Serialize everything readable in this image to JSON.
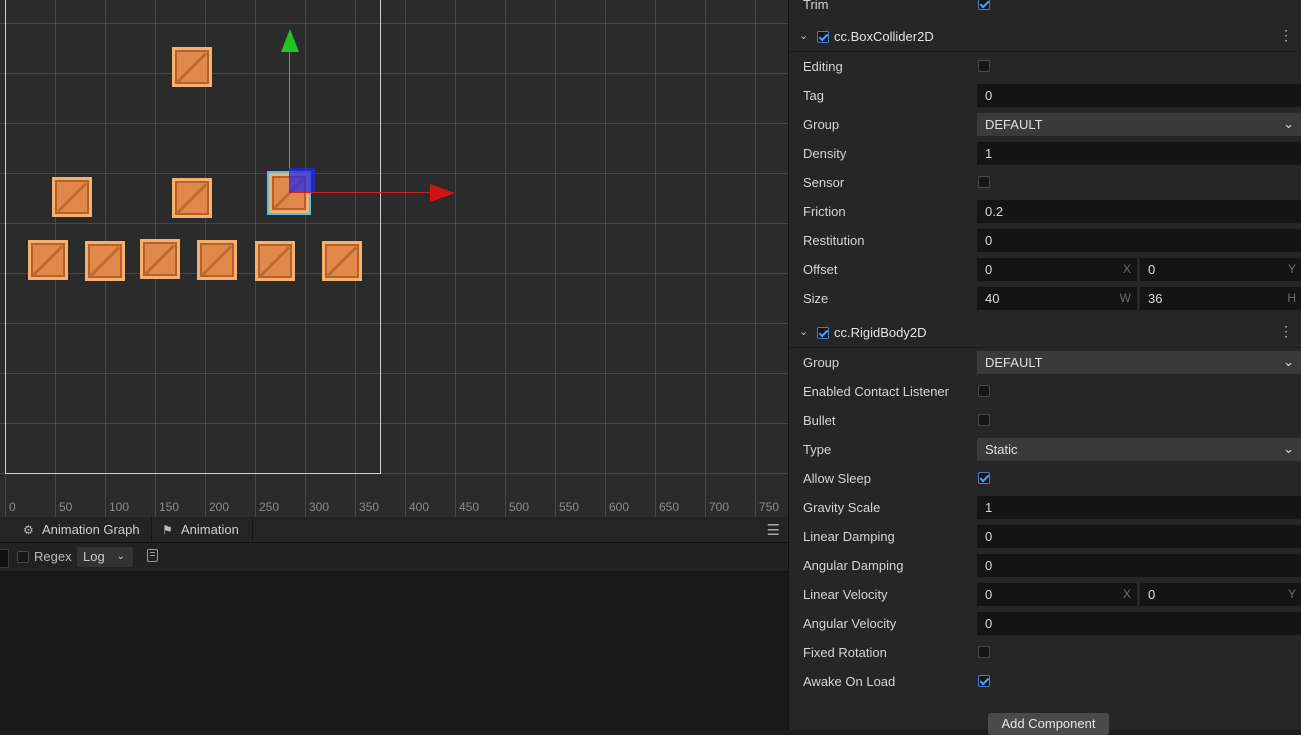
{
  "scene": {
    "ruler_ticks": [
      "0",
      "50",
      "100",
      "150",
      "200",
      "250",
      "300",
      "350",
      "400",
      "450",
      "500",
      "550",
      "600",
      "650",
      "700",
      "750"
    ]
  },
  "bottom_panel": {
    "tabs": [
      {
        "label": "Animation Graph",
        "icon": "animation-graph-icon"
      },
      {
        "label": "Animation",
        "icon": "running-figure-icon"
      }
    ],
    "regex_label": "Regex",
    "log_level": "Log"
  },
  "inspector": {
    "trim": {
      "label": "Trim",
      "checked": true
    },
    "box_collider": {
      "title": "cc.BoxCollider2D",
      "editing_label": "Editing",
      "tag_label": "Tag",
      "tag_value": "0",
      "group_label": "Group",
      "group_value": "DEFAULT",
      "density_label": "Density",
      "density_value": "1",
      "sensor_label": "Sensor",
      "friction_label": "Friction",
      "friction_value": "0.2",
      "restitution_label": "Restitution",
      "restitution_value": "0",
      "offset_label": "Offset",
      "offset_x": "0",
      "offset_y": "0",
      "x_axis": "X",
      "y_axis": "Y",
      "size_label": "Size",
      "size_w": "40",
      "size_h": "36",
      "w_axis": "W",
      "h_axis": "H"
    },
    "rigid_body": {
      "title": "cc.RigidBody2D",
      "group_label": "Group",
      "group_value": "DEFAULT",
      "contact_label": "Enabled Contact Listener",
      "bullet_label": "Bullet",
      "type_label": "Type",
      "type_value": "Static",
      "allow_sleep_label": "Allow Sleep",
      "gravity_label": "Gravity Scale",
      "gravity_value": "1",
      "linear_damping_label": "Linear Damping",
      "linear_damping_value": "0",
      "angular_damping_label": "Angular Damping",
      "angular_damping_value": "0",
      "linear_velocity_label": "Linear Velocity",
      "linear_velocity_x": "0",
      "linear_velocity_y": "0",
      "angular_velocity_label": "Angular Velocity",
      "angular_velocity_value": "0",
      "fixed_rotation_label": "Fixed Rotation",
      "awake_label": "Awake On Load"
    },
    "add_component_label": "Add Component"
  },
  "colors": {
    "crate": "#e0894a",
    "gizmo_x": "#d01414",
    "gizmo_y": "#21c521",
    "gizmo_center": "#2828e6",
    "checkbox_accent": "#4aa0ff"
  }
}
